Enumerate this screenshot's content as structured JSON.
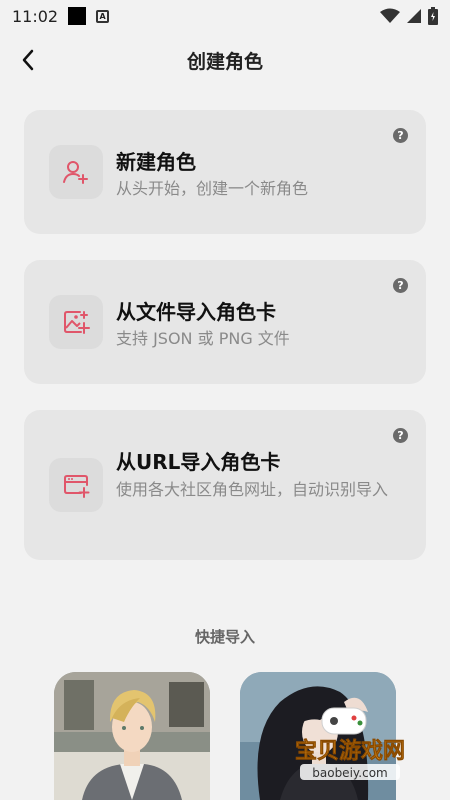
{
  "status_bar": {
    "time": "11:02",
    "notification_icons": [
      "black-square-icon",
      "a-box-icon"
    ],
    "right_icons": [
      "wifi-icon",
      "signal-icon",
      "battery-icon"
    ]
  },
  "header": {
    "title": "创建角色",
    "back_icon": "chevron-left-icon"
  },
  "cards": [
    {
      "title": "新建角色",
      "desc": "从头开始，创建一个新角色",
      "icon": "person-add-icon",
      "help": "?"
    },
    {
      "title": "从文件导入角色卡",
      "desc": "支持 JSON 或 PNG 文件",
      "icon": "image-add-icon",
      "help": "?"
    },
    {
      "title": "从URL导入角色卡",
      "desc": "使用各大社区角色网址，自动识别导入",
      "icon": "browser-add-icon",
      "help": "?"
    }
  ],
  "quick_import": {
    "title": "快捷导入"
  },
  "watermark": {
    "main": "宝贝游戏网",
    "sub": "baobeiy.com"
  },
  "colors": {
    "accent": "#e0566a",
    "background": "#f2f2f2",
    "card": "#e6e6e6"
  }
}
